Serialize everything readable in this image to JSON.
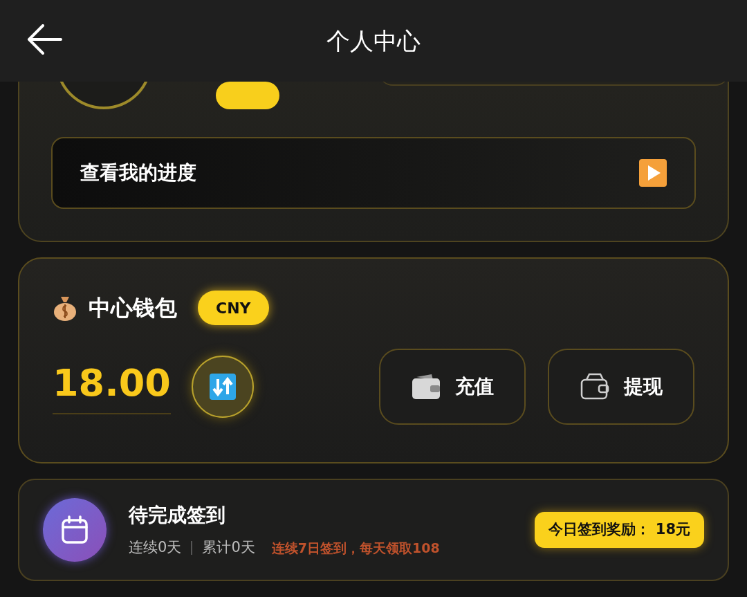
{
  "header": {
    "title": "个人中心"
  },
  "profile": {
    "progress_button": "查看我的进度"
  },
  "wallet": {
    "title": "中心钱包",
    "currency": "CNY",
    "balance": "18.00",
    "actions": [
      {
        "label": "充值",
        "kind": "recharge"
      },
      {
        "label": "提现",
        "kind": "withdraw"
      }
    ]
  },
  "checkin": {
    "title": "待完成签到",
    "streak": "连续0天",
    "total": "累计0天",
    "promo": "连续7日签到，每天领取108",
    "reward": "今日签到奖励： 18元"
  }
}
